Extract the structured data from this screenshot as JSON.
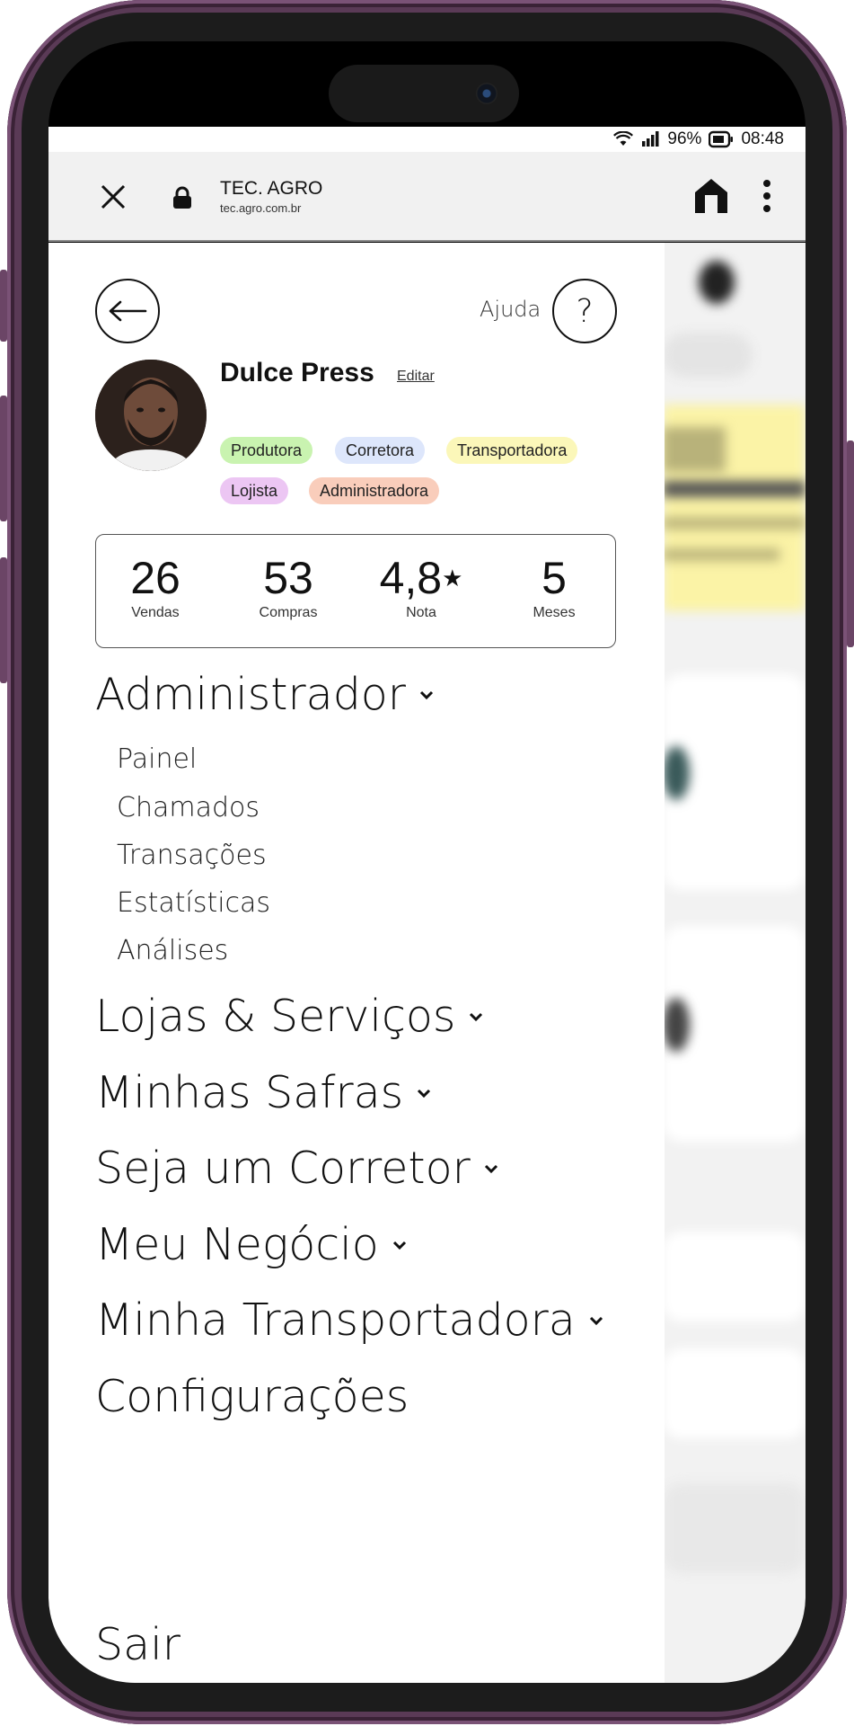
{
  "status_bar": {
    "battery": "96%",
    "time": "08:48"
  },
  "browser": {
    "title": "TEC. AGRO",
    "url": "tec.agro.com.br"
  },
  "drawer": {
    "help_label": "Ajuda",
    "help_glyph": "?",
    "user": {
      "name": "Dulce Press",
      "edit_label": "Editar"
    },
    "roles": [
      {
        "label": "Produtora",
        "color": "#c9f3b0"
      },
      {
        "label": "Corretora",
        "color": "#dde6fb"
      },
      {
        "label": "Transportadora",
        "color": "#fbf7b9"
      },
      {
        "label": "Lojista",
        "color": "#ecc6f3"
      },
      {
        "label": "Administradora",
        "color": "#f9cdbb"
      }
    ],
    "stats": [
      {
        "value": "26",
        "label": "Vendas"
      },
      {
        "value": "53",
        "label": "Compras"
      },
      {
        "value": "4,8",
        "suffix": "★",
        "label": "Nota"
      },
      {
        "value": "5",
        "label": "Meses"
      }
    ],
    "menu": {
      "admin": {
        "title": "Administrador",
        "items": [
          "Painel",
          "Chamados",
          "Transações",
          "Estatísticas",
          "Análises"
        ]
      },
      "stores": "Lojas & Serviços",
      "harvests": "Minhas Safras",
      "broker": "Seja um Corretor",
      "business": "Meu Negócio",
      "carrier": "Minha Transportadora",
      "settings": "Configurações",
      "logout": "Sair"
    }
  }
}
